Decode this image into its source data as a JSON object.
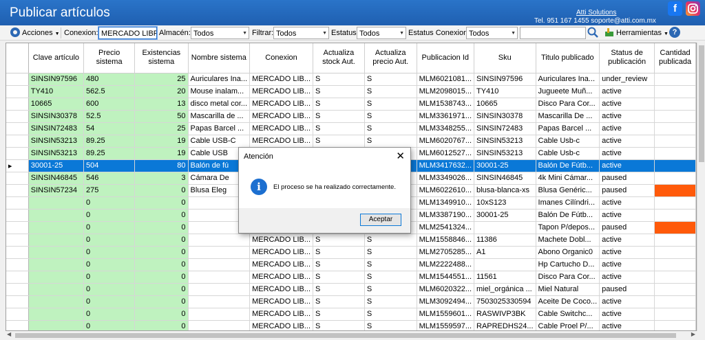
{
  "window": {
    "title": "Publicar artículos",
    "company": "Atti Solutions",
    "contact": "Tel. 951 167 1455  soporte@atti.com.mx"
  },
  "toolbar": {
    "acciones": "Acciones",
    "conexion_label": "Conexion:",
    "conexion_value": "MERCADO LIBR",
    "almacen_label": "Almacén:",
    "almacen_value": "Todos",
    "filtrar_label": "Filtrar:",
    "filtrar_value": "Todos",
    "estatus_label": "Estatus",
    "estatus_value": "Todos",
    "estatus_conexion_label": "Estatus Conexion:",
    "estatus_conexion_value": "Todos",
    "search_value": "",
    "herramientas": "Herramientas"
  },
  "grid": {
    "headers": [
      "Clave artículo",
      "Precio sistema",
      "Existencias sistema",
      "Nombre sistema",
      "Conexion",
      "Actualiza stock Aut.",
      "Actualiza precio Aut.",
      "Publicacion Id",
      "Sku",
      "Titulo publicado",
      "Status de publicación",
      "Cantidad publicada"
    ],
    "rows": [
      [
        "SINSIN97596",
        "480",
        "25",
        "Auriculares Ina...",
        "MERCADO LIB...",
        "S",
        "S",
        "MLM6021081...",
        "SINSIN97596",
        "Auriculares Ina...",
        "under_review",
        ""
      ],
      [
        "TY410",
        "562.5",
        "20",
        "Mouse inalam...",
        "MERCADO LIB...",
        "S",
        "S",
        "MLM2098015...",
        "TY410",
        "Jugueete Muñ...",
        "active",
        ""
      ],
      [
        "10665",
        "600",
        "13",
        "disco metal cor...",
        "MERCADO LIB...",
        "S",
        "S",
        "MLM1538743...",
        "10665",
        "Disco Para Cor...",
        "active",
        ""
      ],
      [
        "SINSIN30378",
        "52.5",
        "50",
        "Mascarilla de ...",
        "MERCADO LIB...",
        "S",
        "S",
        "MLM3361971...",
        "SINSIN30378",
        "Mascarilla De ...",
        "active",
        ""
      ],
      [
        "SINSIN72483",
        "54",
        "25",
        "Papas Barcel ...",
        "MERCADO LIB...",
        "S",
        "S",
        "MLM3348255...",
        "SINSIN72483",
        "Papas Barcel ...",
        "active",
        ""
      ],
      [
        "SINSIN53213",
        "89.25",
        "19",
        "Cable USB-C",
        "MERCADO LIB...",
        "S",
        "S",
        "MLM6020767...",
        "SINSIN53213",
        "Cable Usb-c",
        "active",
        ""
      ],
      [
        "SINSIN53213",
        "89.25",
        "19",
        "Cable USB",
        "",
        "",
        "",
        "MLM6012527...",
        "SINSIN53213",
        "Cable Usb-c",
        "active",
        ""
      ],
      [
        "30001-25",
        "504",
        "80",
        "Balón de fú",
        "",
        "",
        "",
        "MLM3417632...",
        "30001-25",
        "Balón De Fútb...",
        "active",
        ""
      ],
      [
        "SINSIN46845",
        "546",
        "3",
        "Cámara De",
        "",
        "",
        "",
        "MLM3349026...",
        "SINSIN46845",
        "4k Mini Cámar...",
        "paused",
        ""
      ],
      [
        "SINSIN57234",
        "275",
        "0",
        "Blusa Eleg",
        "",
        "",
        "",
        "MLM6022610...",
        "blusa-blanca-xs",
        "Blusa Genéric...",
        "paused",
        ""
      ],
      [
        "",
        "0",
        "0",
        "",
        "",
        "",
        "",
        "MLM1349910...",
        "10xS123",
        "Imanes Cilíndri...",
        "active",
        ""
      ],
      [
        "",
        "0",
        "0",
        "",
        "",
        "",
        "",
        "MLM3387190...",
        "30001-25",
        "Balón De Fútb...",
        "active",
        ""
      ],
      [
        "",
        "0",
        "0",
        "",
        "",
        "",
        "",
        "MLM2541324...",
        "",
        "Tapon P/depos...",
        "paused",
        ""
      ],
      [
        "",
        "0",
        "0",
        "",
        "MERCADO LIB...",
        "S",
        "S",
        "MLM1558846...",
        "11386",
        "Machete Dobl...",
        "active",
        ""
      ],
      [
        "",
        "0",
        "0",
        "",
        "MERCADO LIB...",
        "S",
        "S",
        "MLM2705285...",
        "A1",
        "Abono Organic0",
        "active",
        ""
      ],
      [
        "",
        "0",
        "0",
        "",
        "MERCADO LIB...",
        "S",
        "S",
        "MLM2222488...",
        "",
        "Hp Cartucho D...",
        "active",
        ""
      ],
      [
        "",
        "0",
        "0",
        "",
        "MERCADO LIB...",
        "S",
        "S",
        "MLM1544551...",
        "11561",
        "Disco Para Cor...",
        "active",
        ""
      ],
      [
        "",
        "0",
        "0",
        "",
        "MERCADO LIB...",
        "S",
        "S",
        "MLM6020322...",
        "miel_orgánica ...",
        "Miel Natural",
        "paused",
        ""
      ],
      [
        "",
        "0",
        "0",
        "",
        "MERCADO LIB...",
        "S",
        "S",
        "MLM3092494...",
        "7503025330594",
        "Aceite De Coco...",
        "active",
        ""
      ],
      [
        "",
        "0",
        "0",
        "",
        "MERCADO LIB...",
        "S",
        "S",
        "MLM1559601...",
        "RASWIVP3BK",
        "Cable Switchc...",
        "active",
        ""
      ],
      [
        "",
        "0",
        "0",
        "",
        "MERCADO LIB...",
        "S",
        "S",
        "MLM1559597...",
        "RAPREDHS24...",
        "Cable Proel P/...",
        "active",
        ""
      ]
    ],
    "selected_row": 7,
    "orange_rows": [
      9,
      12
    ]
  },
  "dialog": {
    "title": "Atención",
    "message": "El proceso se ha realizado correctamente.",
    "ok": "Aceptar"
  },
  "colors": {
    "titlebar": "#2a74c9",
    "green_cell": "#bff2bf",
    "selected": "#0a78d7",
    "orange": "#ff5a0a"
  }
}
